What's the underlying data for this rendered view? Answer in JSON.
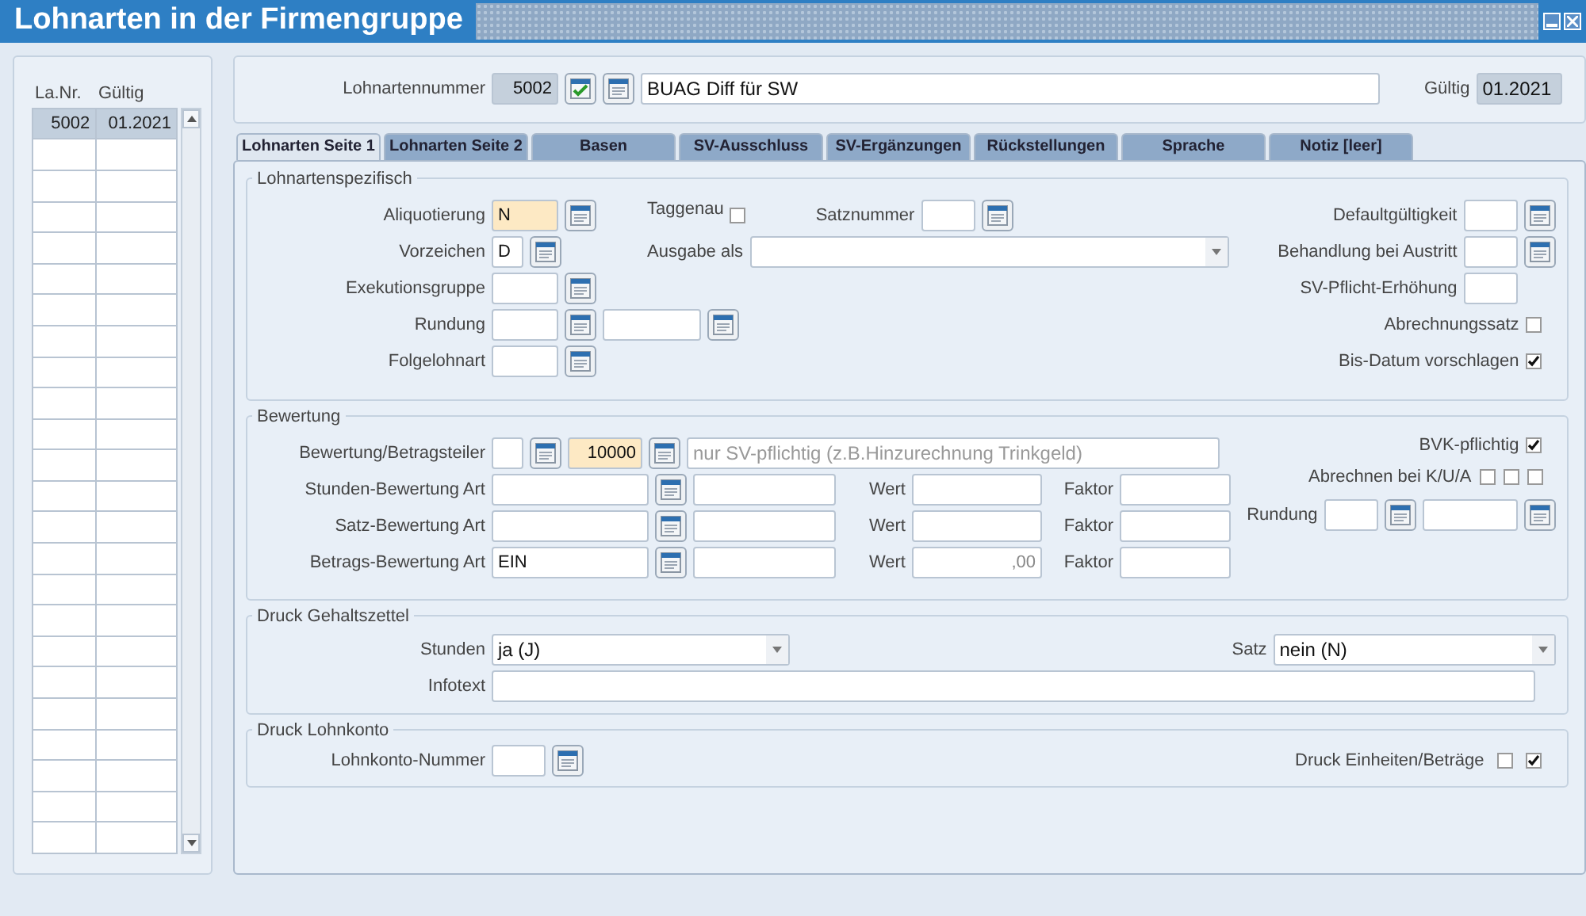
{
  "window": {
    "title": "Lohnarten in der Firmengruppe"
  },
  "list": {
    "columns": [
      "La.Nr.",
      "Gültig"
    ],
    "rows": [
      {
        "number": "5002",
        "valid": "01.2021",
        "selected": true
      }
    ]
  },
  "header": {
    "number_label": "Lohnartennummer",
    "number": "5002",
    "name": "BUAG Diff für SW",
    "valid_label": "Gültig",
    "valid": "01.2021"
  },
  "tabs": [
    {
      "label": "Lohnarten Seite 1",
      "selected": true
    },
    {
      "label": "Lohnarten Seite 2",
      "selected": false
    },
    {
      "label": "Basen",
      "selected": false
    },
    {
      "label": "SV-Ausschluss",
      "selected": false
    },
    {
      "label": "SV-Ergänzungen",
      "selected": false
    },
    {
      "label": "Rückstellungen",
      "selected": false
    },
    {
      "label": "Sprache",
      "selected": false
    },
    {
      "label": "Notiz [leer]",
      "selected": false
    }
  ],
  "spezifisch": {
    "title": "Lohnartenspezifisch",
    "aliquotierung": {
      "label": "Aliquotierung",
      "value": "N",
      "highlighted": true
    },
    "vorzeichen": {
      "label": "Vorzeichen",
      "value": "D"
    },
    "exekutionsgruppe": {
      "label": "Exekutionsgruppe"
    },
    "rundung": {
      "label": "Rundung"
    },
    "folgelohnart": {
      "label": "Folgelohnart"
    },
    "taggenau": {
      "label": "Taggenau",
      "checked": false
    },
    "satznummer": {
      "label": "Satznummer"
    },
    "ausgabe_als": {
      "label": "Ausgabe als"
    },
    "defaultgueltigkeit": {
      "label": "Defaultgültigkeit"
    },
    "behandlung_austritt": {
      "label": "Behandlung bei Austritt"
    },
    "sv_pflicht_erhoehung": {
      "label": "SV-Pflicht-Erhöhung"
    },
    "abrechnungssatz": {
      "label": "Abrechnungssatz",
      "checked": false
    },
    "bis_datum": {
      "label": "Bis-Datum vorschlagen",
      "checked": true
    }
  },
  "bewertung": {
    "title": "Bewertung",
    "betragsteiler": {
      "label": "Bewertung/Betragsteiler",
      "value": "10000",
      "highlighted": true,
      "placeholder": "nur SV-pflichtig (z.B.Hinzurechnung Trinkgeld)"
    },
    "rows": [
      {
        "label": "Stunden-Bewertung Art",
        "wert_label": "Wert",
        "faktor_label": "Faktor"
      },
      {
        "label": "Satz-Bewertung Art",
        "wert_label": "Wert",
        "faktor_label": "Faktor"
      },
      {
        "label": "Betrags-Bewertung Art",
        "value": "EIN",
        "wert_label": "Wert",
        "wert": ",00",
        "faktor_label": "Faktor"
      }
    ],
    "bvk": {
      "label": "BVK-pflichtig",
      "checked": true
    },
    "abrechnen": {
      "label": "Abrechnen bei K/U/A",
      "checks": [
        {
          "checked": false
        },
        {
          "checked": false
        },
        {
          "checked": false
        }
      ]
    },
    "rundung": {
      "label": "Rundung"
    }
  },
  "gehaltszettel": {
    "title": "Druck Gehaltszettel",
    "stunden": {
      "label": "Stunden",
      "value": "ja (J)"
    },
    "satz": {
      "label": "Satz",
      "value": "nein (N)"
    },
    "infotext": {
      "label": "Infotext"
    }
  },
  "lohnkonto": {
    "title": "Druck Lohnkonto",
    "nummer": {
      "label": "Lohnkonto-Nummer"
    },
    "einheiten": {
      "label": "Druck Einheiten/Beträge",
      "checks": [
        {
          "checked": false
        },
        {
          "checked": true
        }
      ]
    }
  }
}
